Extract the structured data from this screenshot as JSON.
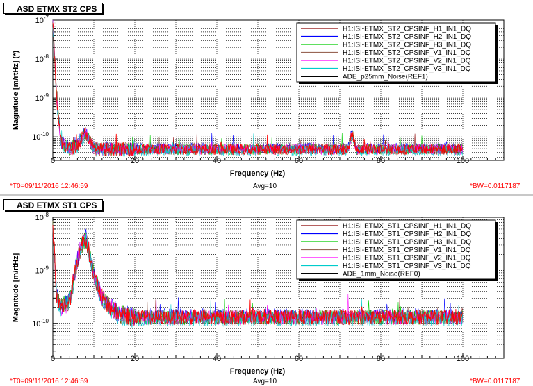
{
  "chart_data": [
    {
      "type": "line",
      "title": "ASD ETMX ST2 CPS",
      "xlabel": "Frequency (Hz)",
      "ylabel": "Magnitude [m/rtHz] (*)",
      "xlim": [
        0,
        110
      ],
      "ylim": [
        2.5e-11,
        1e-07
      ],
      "yscale": "log",
      "x_ticks": [
        0,
        20,
        40,
        60,
        80,
        100
      ],
      "y_ticks": [
        {
          "value": 1e-10,
          "mant": "10",
          "exp": "-10"
        },
        {
          "value": 1e-09,
          "mant": "10",
          "exp": "-9"
        },
        {
          "value": 1e-08,
          "mant": "10",
          "exp": "-8"
        },
        {
          "value": 1e-07,
          "mant": "10",
          "exp": "-7"
        }
      ],
      "grid": true,
      "legend_position": "top-right",
      "series": [
        {
          "name": "H1:ISI-ETMX_ST2_CPSINF_H1_IN1_DQ",
          "color": "#8b0000"
        },
        {
          "name": "H1:ISI-ETMX_ST2_CPSINF_H2_IN1_DQ",
          "color": "#0000ff"
        },
        {
          "name": "H1:ISI-ETMX_ST2_CPSINF_H3_IN1_DQ",
          "color": "#00cc00"
        },
        {
          "name": "H1:ISI-ETMX_ST2_CPSINF_V1_IN1_DQ",
          "color": "#996655"
        },
        {
          "name": "H1:ISI-ETMX_ST2_CPSINF_V2_IN1_DQ",
          "color": "#ff00ff"
        },
        {
          "name": "H1:ISI-ETMX_ST2_CPSINF_V3_IN1_DQ",
          "color": "#00cccc"
        },
        {
          "name": "ADE_p25mm_Noise(REF1)",
          "color": "#000000"
        }
      ],
      "trace_profile": {
        "x": [
          0,
          1,
          2,
          4,
          6,
          7,
          8,
          9,
          10,
          12,
          20,
          40,
          60,
          72,
          73,
          74,
          100
        ],
        "y": [
          1e-07,
          8e-10,
          7e-11,
          5e-11,
          6e-11,
          9e-11,
          1.3e-10,
          8e-11,
          5e-11,
          4.8e-11,
          4.8e-11,
          4.8e-11,
          4.8e-11,
          4.8e-11,
          1.3e-10,
          4.8e-11,
          4.8e-11
        ]
      },
      "footer": {
        "t0": "*T0=09/11/2016 12:46:59",
        "avg": "Avg=10",
        "bw": "*BW=0.0117187"
      }
    },
    {
      "type": "line",
      "title": "ASD ETMX ST1 CPS",
      "xlabel": "Frequency (Hz)",
      "ylabel": "Magnitude [m/rtHz]",
      "xlim": [
        0,
        110
      ],
      "ylim": [
        2.2e-11,
        1e-08
      ],
      "yscale": "log",
      "x_ticks": [
        0,
        20,
        40,
        60,
        80,
        100
      ],
      "y_ticks": [
        {
          "value": 1e-10,
          "mant": "10",
          "exp": "-10"
        },
        {
          "value": 1e-09,
          "mant": "10",
          "exp": "-9"
        },
        {
          "value": 1e-08,
          "mant": "10",
          "exp": "-8"
        }
      ],
      "grid": true,
      "legend_position": "top-right",
      "series": [
        {
          "name": "H1:ISI-ETMX_ST1_CPSINF_H1_IN1_DQ",
          "color": "#8b0000"
        },
        {
          "name": "H1:ISI-ETMX_ST1_CPSINF_H2_IN1_DQ",
          "color": "#0000ff"
        },
        {
          "name": "H1:ISI-ETMX_ST1_CPSINF_H3_IN1_DQ",
          "color": "#00cc00"
        },
        {
          "name": "H1:ISI-ETMX_ST1_CPSINF_V1_IN1_DQ",
          "color": "#996655"
        },
        {
          "name": "H1:ISI-ETMX_ST1_CPSINF_V2_IN1_DQ",
          "color": "#ff00ff"
        },
        {
          "name": "H1:ISI-ETMX_ST1_CPSINF_V3_IN1_DQ",
          "color": "#00cccc"
        },
        {
          "name": "ADE_1mm_Noise(REF0)",
          "color": "#000000"
        }
      ],
      "trace_profile": {
        "x": [
          0,
          1,
          2,
          4,
          6,
          7,
          8,
          9,
          10,
          12,
          14,
          16,
          20,
          30,
          44,
          60,
          100
        ],
        "y": [
          6e-09,
          3e-10,
          2e-10,
          2.5e-10,
          1.5e-09,
          3e-09,
          4e-09,
          2e-09,
          8e-10,
          3e-10,
          2e-10,
          1.5e-10,
          1.3e-10,
          1.3e-10,
          1.3e-10,
          1.3e-10,
          1.3e-10
        ]
      },
      "footer": {
        "t0": "*T0=09/11/2016 12:46:59",
        "avg": "Avg=10",
        "bw": "*BW=0.0117187"
      }
    }
  ]
}
